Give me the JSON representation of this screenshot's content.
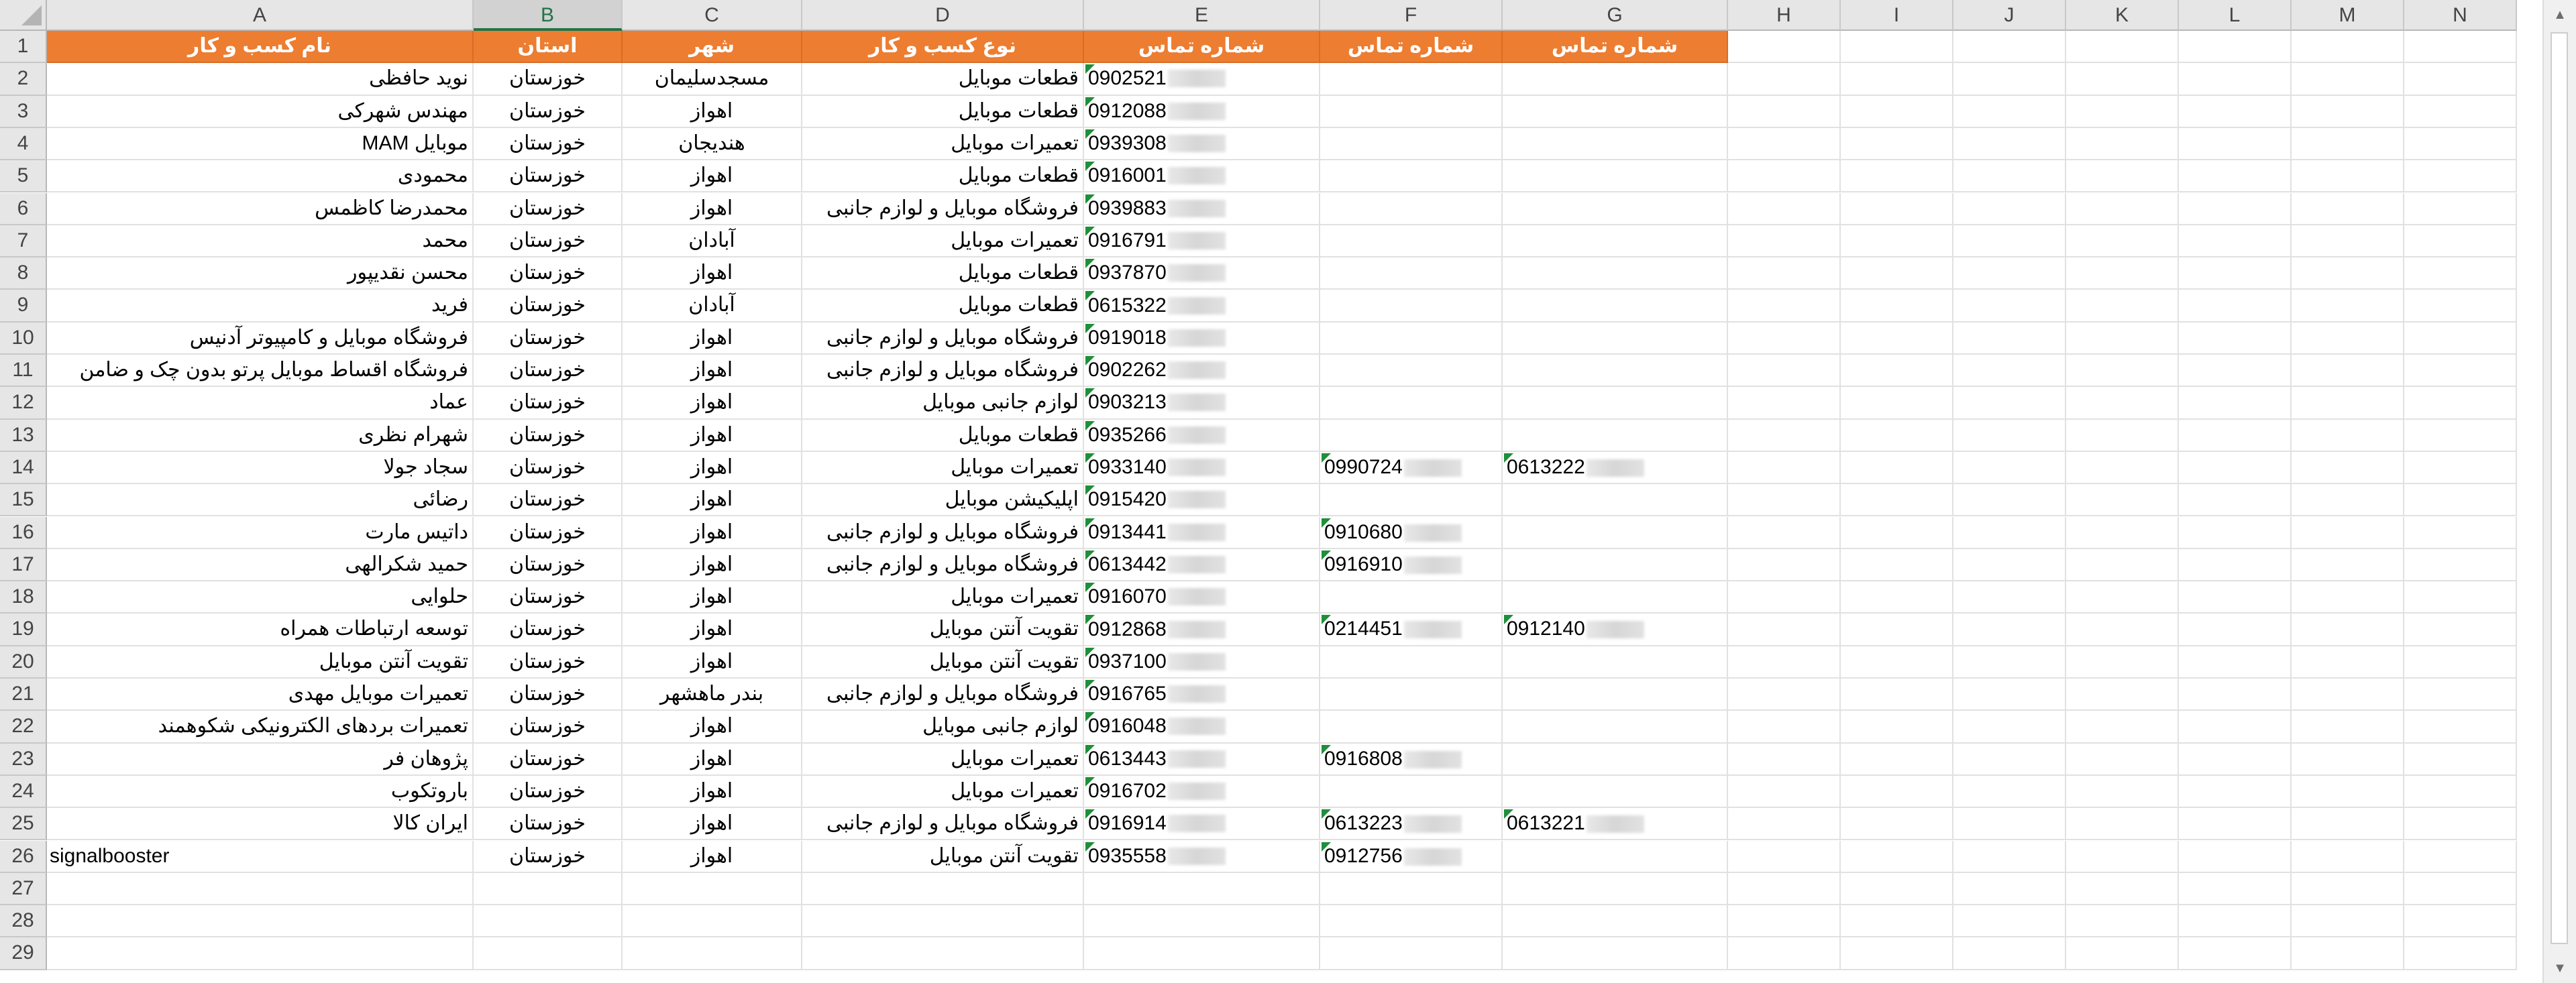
{
  "sheet": {
    "columns": [
      "A",
      "B",
      "C",
      "D",
      "E",
      "F",
      "G",
      "H",
      "I",
      "J",
      "K",
      "L",
      "M",
      "N"
    ],
    "selected_column": "B",
    "row_numbers": [
      "1",
      "2",
      "3",
      "4",
      "5",
      "6",
      "7",
      "8",
      "9",
      "10",
      "11",
      "12",
      "13",
      "14",
      "15",
      "16",
      "17",
      "18",
      "19",
      "20",
      "21",
      "22",
      "23",
      "24",
      "25",
      "26",
      "27",
      "28",
      "29"
    ],
    "header_row": [
      "نام کسب و کار",
      "استان",
      "شهر",
      "نوع کسب و کار",
      "شماره تماس",
      "شماره تماس",
      "شماره تماس"
    ],
    "rows": [
      {
        "name": "نوید حافظی",
        "province": "خوزستان",
        "city": "مسجدسلیمان",
        "type": "قطعات موبایل",
        "phone1": "0902521",
        "phone2": "",
        "phone3": ""
      },
      {
        "name": "مهندس شهرکی",
        "province": "خوزستان",
        "city": "اهواز",
        "type": "قطعات موبایل",
        "phone1": "0912088",
        "phone2": "",
        "phone3": ""
      },
      {
        "name": "موبایل MAM",
        "province": "خوزستان",
        "city": "هندیجان",
        "type": "تعمیرات موبایل",
        "phone1": "0939308",
        "phone2": "",
        "phone3": ""
      },
      {
        "name": "محمودی",
        "province": "خوزستان",
        "city": "اهواز",
        "type": "قطعات موبایل",
        "phone1": "0916001",
        "phone2": "",
        "phone3": ""
      },
      {
        "name": "محمدرضا کاظمس",
        "province": "خوزستان",
        "city": "اهواز",
        "type": "فروشگاه موبایل و لوازم جانبی",
        "phone1": "0939883",
        "phone2": "",
        "phone3": ""
      },
      {
        "name": "محمد",
        "province": "خوزستان",
        "city": "آبادان",
        "type": "تعمیرات موبایل",
        "phone1": "0916791",
        "phone2": "",
        "phone3": ""
      },
      {
        "name": "محسن نقدیپور",
        "province": "خوزستان",
        "city": "اهواز",
        "type": "قطعات موبایل",
        "phone1": "0937870",
        "phone2": "",
        "phone3": ""
      },
      {
        "name": "فرید",
        "province": "خوزستان",
        "city": "آبادان",
        "type": "قطعات موبایل",
        "phone1": "0615322",
        "phone2": "",
        "phone3": ""
      },
      {
        "name": "فروشگاه موبایل و کامپیوتر آدنیس",
        "province": "خوزستان",
        "city": "اهواز",
        "type": "فروشگاه موبایل و لوازم جانبی",
        "phone1": "0919018",
        "phone2": "",
        "phone3": ""
      },
      {
        "name": "فروشگاه اقساط موبایل پرتو بدون چک و ضامن",
        "province": "خوزستان",
        "city": "اهواز",
        "type": "فروشگاه موبایل و لوازم جانبی",
        "phone1": "0902262",
        "phone2": "",
        "phone3": ""
      },
      {
        "name": "عماد",
        "province": "خوزستان",
        "city": "اهواز",
        "type": "لوازم جانبی موبایل",
        "phone1": "0903213",
        "phone2": "",
        "phone3": ""
      },
      {
        "name": "شهرام نظری",
        "province": "خوزستان",
        "city": "اهواز",
        "type": "قطعات موبایل",
        "phone1": "0935266",
        "phone2": "",
        "phone3": ""
      },
      {
        "name": "سجاد جولا",
        "province": "خوزستان",
        "city": "اهواز",
        "type": "تعمیرات موبایل",
        "phone1": "0933140",
        "phone2": "0990724",
        "phone3": "0613222"
      },
      {
        "name": "رضائی",
        "province": "خوزستان",
        "city": "اهواز",
        "type": "اپلیکیشن موبایل",
        "phone1": "0915420",
        "phone2": "",
        "phone3": ""
      },
      {
        "name": "داتیس مارت",
        "province": "خوزستان",
        "city": "اهواز",
        "type": "فروشگاه موبایل و لوازم جانبی",
        "phone1": "0913441",
        "phone2": "0910680",
        "phone3": ""
      },
      {
        "name": "حمید شکرالهی",
        "province": "خوزستان",
        "city": "اهواز",
        "type": "فروشگاه موبایل و لوازم جانبی",
        "phone1": "0613442",
        "phone2": "0916910",
        "phone3": ""
      },
      {
        "name": "حلوایی",
        "province": "خوزستان",
        "city": "اهواز",
        "type": "تعمیرات موبایل",
        "phone1": "0916070",
        "phone2": "",
        "phone3": ""
      },
      {
        "name": "توسعه ارتباطات همراه",
        "province": "خوزستان",
        "city": "اهواز",
        "type": "تقویت آنتن موبایل",
        "phone1": "0912868",
        "phone2": "0214451",
        "phone3": "0912140"
      },
      {
        "name": "تقویت آنتن موبایل",
        "province": "خوزستان",
        "city": "اهواز",
        "type": "تقویت آنتن موبایل",
        "phone1": "0937100",
        "phone2": "",
        "phone3": ""
      },
      {
        "name": "تعمیرات موبایل مهدی",
        "province": "خوزستان",
        "city": "بندر ماهشهر",
        "type": "فروشگاه موبایل و لوازم جانبی",
        "phone1": "0916765",
        "phone2": "",
        "phone3": ""
      },
      {
        "name": "تعمیرات بردهای الکترونیکی شکوهمند",
        "province": "خوزستان",
        "city": "اهواز",
        "type": "لوازم جانبی موبایل",
        "phone1": "0916048",
        "phone2": "",
        "phone3": ""
      },
      {
        "name": "پژوهان فر",
        "province": "خوزستان",
        "city": "اهواز",
        "type": "تعمیرات موبایل",
        "phone1": "0613443",
        "phone2": "0916808",
        "phone3": ""
      },
      {
        "name": "باروتکوب",
        "province": "خوزستان",
        "city": "اهواز",
        "type": "تعمیرات موبایل",
        "phone1": "0916702",
        "phone2": "",
        "phone3": ""
      },
      {
        "name": "ایران کالا",
        "province": "خوزستان",
        "city": "اهواز",
        "type": "فروشگاه موبایل و لوازم جانبی",
        "phone1": "0916914",
        "phone2": "0613223",
        "phone3": "0613221"
      },
      {
        "name": "signalbooster",
        "province": "خوزستان",
        "city": "اهواز",
        "type": "تقویت آنتن موبایل",
        "phone1": "0935558",
        "phone2": "0912756",
        "phone3": ""
      }
    ]
  },
  "scrollbar": {
    "up_arrow": "▲",
    "down_arrow": "▼"
  },
  "colors": {
    "header_fill": "#ed7d31",
    "header_text": "#ffffff",
    "selected_col": "#217346"
  }
}
